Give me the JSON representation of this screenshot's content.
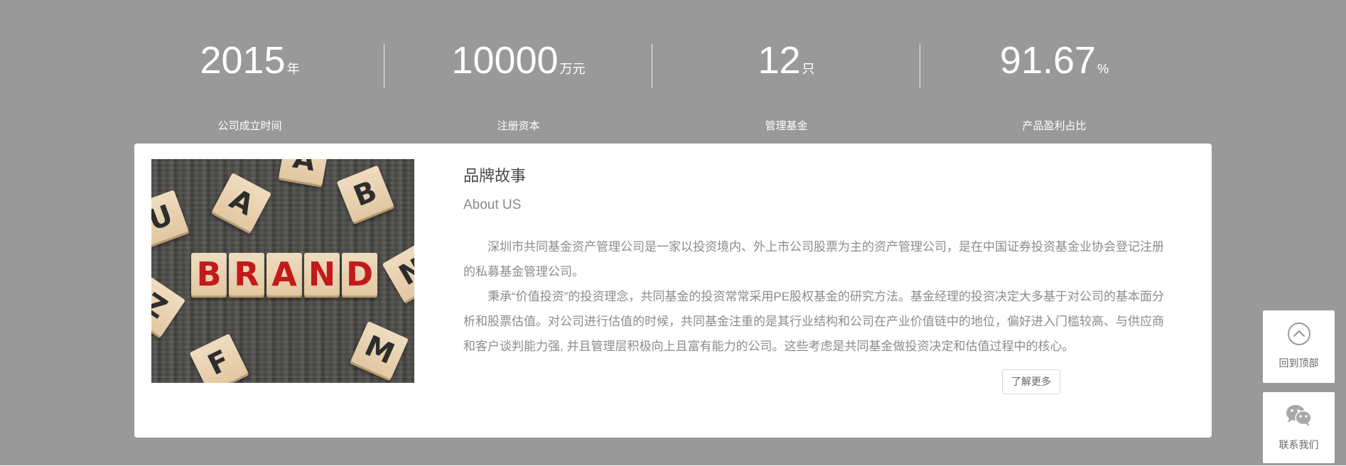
{
  "stats": [
    {
      "value": "2015",
      "unit": "年",
      "label": "公司成立时间"
    },
    {
      "value": "10000",
      "unit": "万元",
      "label": "注册资本"
    },
    {
      "value": "12",
      "unit": "只",
      "label": "管理基金"
    },
    {
      "value": "91.67",
      "unit": "%",
      "label": "产品盈利占比"
    }
  ],
  "card": {
    "image_letters": [
      "B",
      "R",
      "A",
      "N",
      "D"
    ],
    "image_scatter_letters": [
      "U",
      "A",
      "B",
      "A",
      "F",
      "M",
      "N",
      "Z"
    ],
    "title": "品牌故事",
    "subtitle": "About US",
    "paragraphs": [
      "深圳市共同基金资产管理公司是一家以投资境内、外上市公司股票为主的资产管理公司，是在中国证券投资基金业协会登记注册的私募基金管理公司。",
      "秉承“价值投资”的投资理念，共同基金的投资常常采用PE股权基金的研究方法。基金经理的投资决定大多基于对公司的基本面分析和股票估值。对公司进行估值的时候，共同基金注重的是其行业结构和公司在产业价值链中的地位，偏好进入门槛较高、与供应商和客户谈判能力强, 并且管理层积极向上且富有能力的公司。这些考虑是共同基金做投资决定和估值过程中的核心。"
    ],
    "more_label": "了解更多"
  },
  "side": {
    "back_top_label": "回到顶部",
    "back_top_icon": "chevron-up-circle-icon",
    "contact_label": "联系我们",
    "contact_icon": "wechat-icon"
  },
  "colors": {
    "band": "#999999",
    "card": "#ffffff",
    "brand_letters": "#c21a1a"
  }
}
